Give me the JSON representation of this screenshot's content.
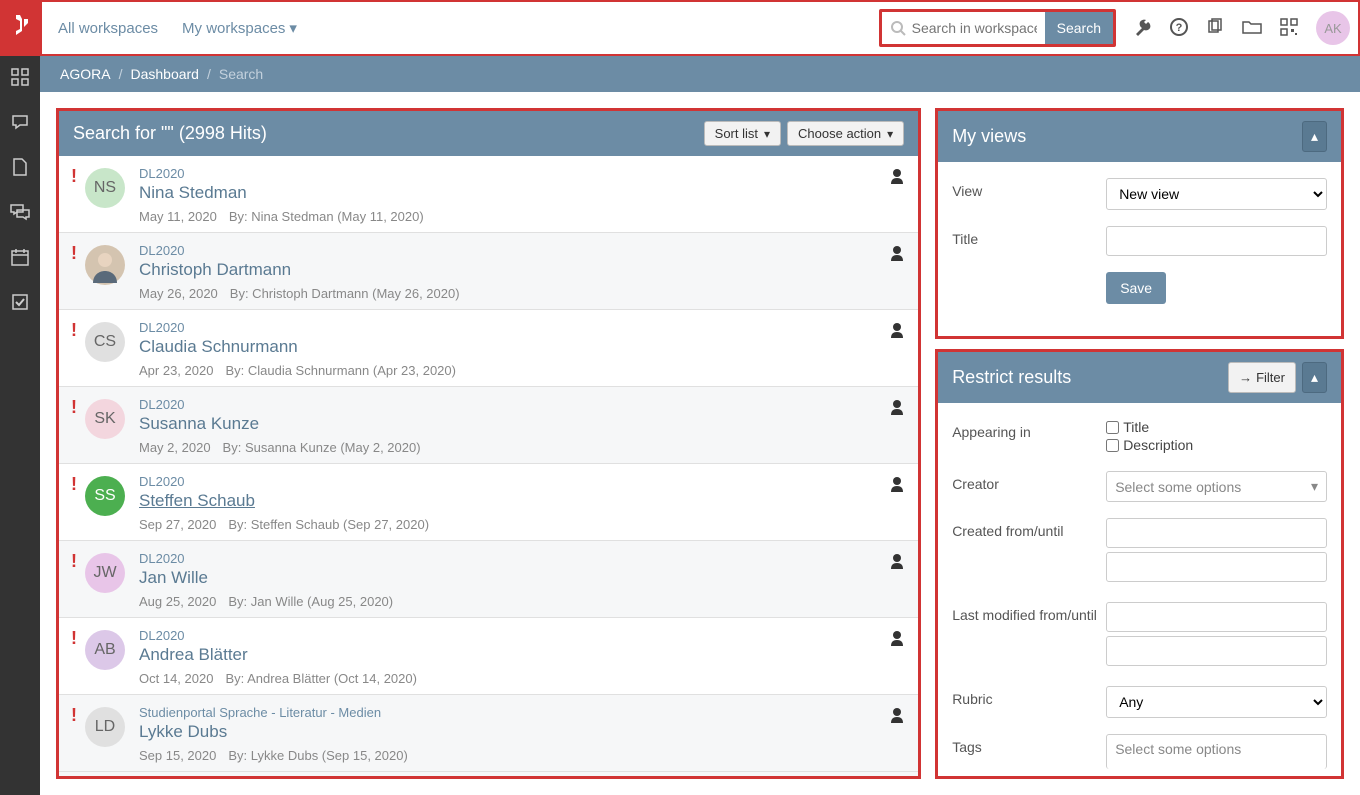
{
  "nav": {
    "all_workspaces": "All workspaces",
    "my_workspaces": "My workspaces"
  },
  "search": {
    "placeholder": "Search in workspace.",
    "button": "Search"
  },
  "user_avatar": "AK",
  "breadcrumb": {
    "root": "AGORA",
    "section": "Dashboard",
    "current": "Search"
  },
  "results_panel": {
    "title": "Search for \"\" (2998 Hits)",
    "sort_btn": "Sort list",
    "action_btn": "Choose action"
  },
  "avatar_colors": [
    "#c8e6c9",
    "#fff",
    "#e0e0e0",
    "#f3d6de",
    "#4caf50",
    "#e8c5e8",
    "#dcc8e8",
    "#e0e0e0"
  ],
  "avatar_text_colors": [
    "#666",
    "#666",
    "#666",
    "#666",
    "#fff",
    "#666",
    "#666",
    "#666"
  ],
  "results": [
    {
      "initials": "NS",
      "tag": "DL2020",
      "name": "Nina Stedman",
      "date": "May 11, 2020",
      "by": "By: Nina Stedman (May 11, 2020)",
      "underline": false,
      "photo": false
    },
    {
      "initials": "",
      "tag": "DL2020",
      "name": "Christoph Dartmann",
      "date": "May 26, 2020",
      "by": "By: Christoph Dartmann (May 26, 2020)",
      "underline": false,
      "photo": true
    },
    {
      "initials": "CS",
      "tag": "DL2020",
      "name": "Claudia Schnurmann",
      "date": "Apr 23, 2020",
      "by": "By: Claudia Schnurmann (Apr 23, 2020)",
      "underline": false,
      "photo": false
    },
    {
      "initials": "SK",
      "tag": "DL2020",
      "name": "Susanna Kunze",
      "date": "May 2, 2020",
      "by": "By: Susanna Kunze (May 2, 2020)",
      "underline": false,
      "photo": false
    },
    {
      "initials": "SS",
      "tag": "DL2020",
      "name": "Steffen Schaub",
      "date": "Sep 27, 2020",
      "by": "By: Steffen Schaub (Sep 27, 2020)",
      "underline": true,
      "photo": false
    },
    {
      "initials": "JW",
      "tag": "DL2020",
      "name": "Jan Wille",
      "date": "Aug 25, 2020",
      "by": "By: Jan Wille (Aug 25, 2020)",
      "underline": false,
      "photo": false
    },
    {
      "initials": "AB",
      "tag": "DL2020",
      "name": "Andrea Blätter",
      "date": "Oct 14, 2020",
      "by": "By: Andrea Blätter (Oct 14, 2020)",
      "underline": false,
      "photo": false
    },
    {
      "initials": "LD",
      "tag": "Studienportal Sprache - Literatur - Medien",
      "name": "Lykke Dubs",
      "date": "Sep 15, 2020",
      "by": "By: Lykke Dubs (Sep 15, 2020)",
      "underline": false,
      "photo": false
    }
  ],
  "my_views": {
    "title": "My views",
    "view_label": "View",
    "view_value": "New view",
    "title_label": "Title",
    "save": "Save"
  },
  "restrict": {
    "title": "Restrict results",
    "filter_btn": "Filter",
    "appearing_label": "Appearing in",
    "cb_title": "Title",
    "cb_desc": "Description",
    "creator_label": "Creator",
    "creator_placeholder": "Select some options",
    "created_label": "Created from/until",
    "modified_label": "Last modified from/until",
    "rubric_label": "Rubric",
    "rubric_value": "Any",
    "tags_label": "Tags",
    "tags_placeholder": "Select some options"
  }
}
